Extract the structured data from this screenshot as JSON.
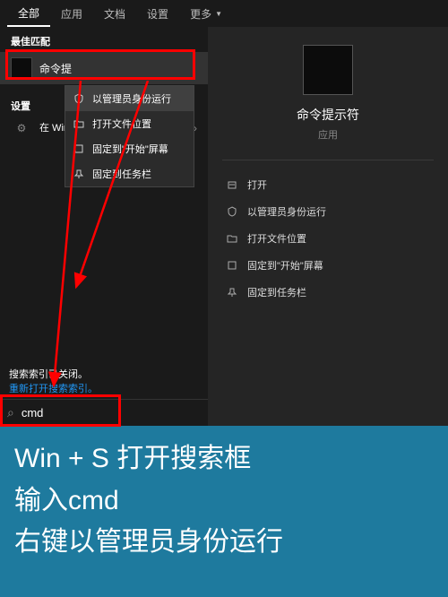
{
  "tabs": {
    "all": "全部",
    "apps": "应用",
    "docs": "文档",
    "settings": "设置",
    "more": "更多"
  },
  "left": {
    "best_match": "最佳匹配",
    "best_result": "命令提",
    "settings_label": "设置",
    "setting_item": "在 Win + 换为 Wi"
  },
  "ctx": {
    "run_admin": "以管理员身份运行",
    "open_loc": "打开文件位置",
    "pin_start": "固定到\"开始\"屏幕",
    "pin_task": "固定到任务栏"
  },
  "detail": {
    "title": "命令提示符",
    "sub": "应用",
    "open": "打开",
    "run_admin": "以管理员身份运行",
    "open_loc": "打开文件位置",
    "pin_start": "固定到\"开始\"屏幕",
    "pin_task": "固定到任务栏"
  },
  "status": {
    "off": "搜索索引已关闭。",
    "reopen": "重新打开搜索索引。"
  },
  "search": {
    "value": "cmd"
  },
  "caption": {
    "l1": "Win + S 打开搜索框",
    "l2": "输入cmd",
    "l3": "右键以管理员身份运行"
  }
}
